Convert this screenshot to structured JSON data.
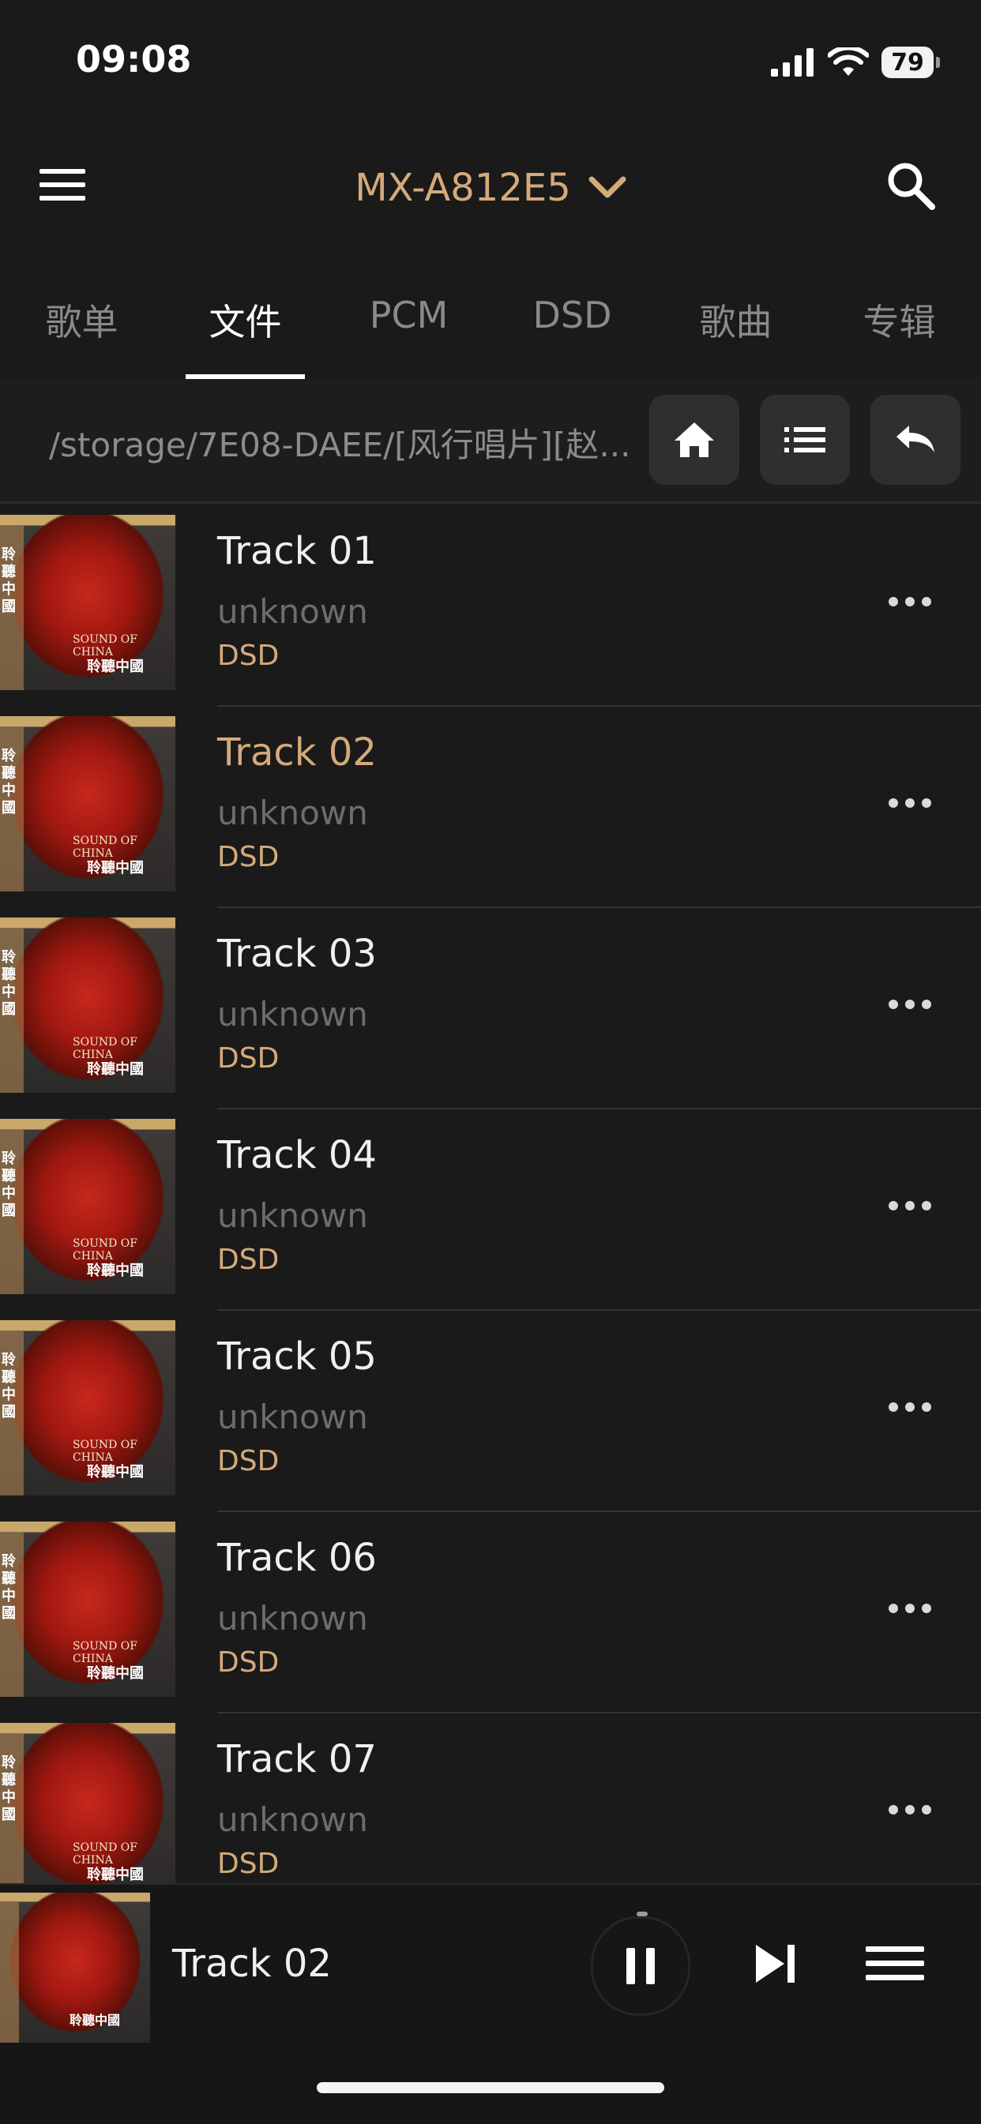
{
  "status_bar": {
    "time": "09:08",
    "battery": "79"
  },
  "header": {
    "device_name": "MX-A812E5"
  },
  "tabs": [
    {
      "label": "歌单",
      "active": false
    },
    {
      "label": "文件",
      "active": true
    },
    {
      "label": "PCM",
      "active": false
    },
    {
      "label": "DSD",
      "active": false
    },
    {
      "label": "歌曲",
      "active": false
    },
    {
      "label": "专辑",
      "active": false
    }
  ],
  "path": {
    "text": "/storage/7E08-DAEE/[风行唱片][赵..."
  },
  "cover": {
    "side_text": "聆聽中國",
    "caption": "SOUND OF CHINA",
    "caption_cn": "聆聽中國"
  },
  "tracks": [
    {
      "title": "Track 01",
      "artist": "unknown",
      "format": "DSD",
      "playing": false
    },
    {
      "title": "Track 02",
      "artist": "unknown",
      "format": "DSD",
      "playing": true
    },
    {
      "title": "Track 03",
      "artist": "unknown",
      "format": "DSD",
      "playing": false
    },
    {
      "title": "Track 04",
      "artist": "unknown",
      "format": "DSD",
      "playing": false
    },
    {
      "title": "Track 05",
      "artist": "unknown",
      "format": "DSD",
      "playing": false
    },
    {
      "title": "Track 06",
      "artist": "unknown",
      "format": "DSD",
      "playing": false
    },
    {
      "title": "Track 07",
      "artist": "unknown",
      "format": "DSD",
      "playing": false
    }
  ],
  "player": {
    "title": "Track 02",
    "state": "playing"
  },
  "colors": {
    "accent": "#d4aa7a",
    "background": "#1a1a1b",
    "muted": "#6d6d6d"
  }
}
